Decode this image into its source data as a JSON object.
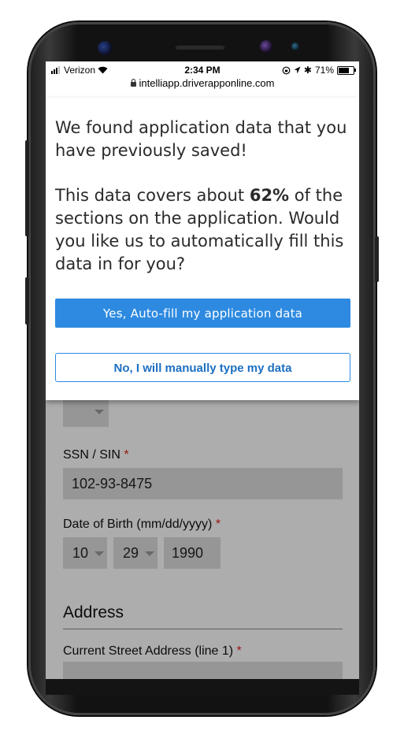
{
  "status": {
    "carrier": "Verizon",
    "time": "2:34 PM",
    "battery": "71%",
    "battery_level": 0.71
  },
  "browser": {
    "url": "intelliapp.driverapponline.com"
  },
  "modal": {
    "line1": "We found application data that you have previously saved!",
    "coverage_prefix": "This data covers about ",
    "coverage_percent": "62%",
    "coverage_suffix": " of the sections on the application. Would you like us to automatically fill this data in for you?",
    "yes_button": "Yes, Auto-fill my application data",
    "no_button": "No, I will manually type my data"
  },
  "form": {
    "ssn_label": "SSN / SIN",
    "ssn_value": "102-93-8475",
    "dob_label": "Date of Birth (mm/dd/yyyy)",
    "dob_month": "10",
    "dob_day": "29",
    "dob_year": "1990",
    "address_heading": "Address",
    "street_label": "Current Street Address (line 1)",
    "required_marker": "*"
  },
  "colors": {
    "primary": "#2d8ae0",
    "required": "#e0261b"
  }
}
